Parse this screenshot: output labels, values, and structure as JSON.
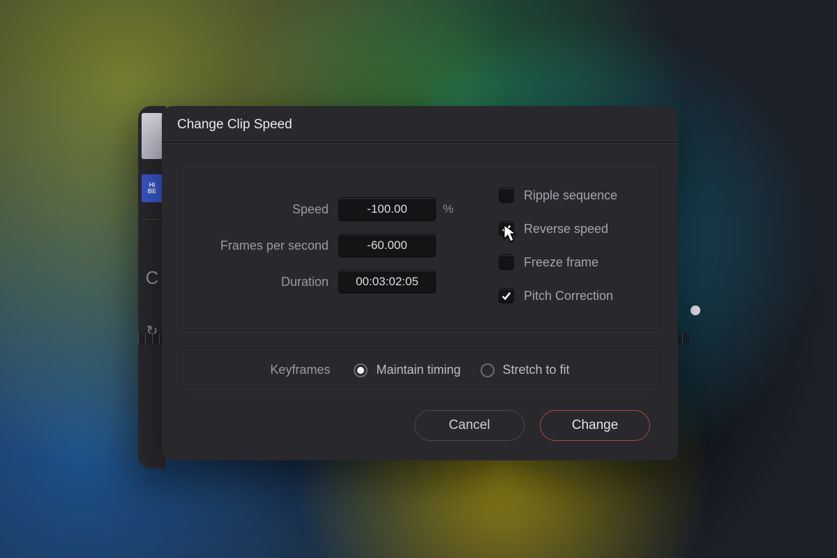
{
  "dialog": {
    "title": "Change Clip Speed",
    "fields": {
      "speed": {
        "label": "Speed",
        "value": "-100.00",
        "unit": "%"
      },
      "fps": {
        "label": "Frames per second",
        "value": "-60.000"
      },
      "duration": {
        "label": "Duration",
        "value": "00:03:02:05"
      }
    },
    "checkboxes": {
      "ripple": {
        "label": "Ripple sequence",
        "checked": false
      },
      "reverse": {
        "label": "Reverse speed",
        "checked": true
      },
      "freeze": {
        "label": "Freeze frame",
        "checked": false
      },
      "pitch": {
        "label": "Pitch Correction",
        "checked": true
      }
    },
    "keyframes": {
      "label": "Keyframes",
      "options": {
        "maintain": {
          "label": "Maintain timing",
          "selected": true
        },
        "stretch": {
          "label": "Stretch to fit",
          "selected": false
        }
      }
    },
    "buttons": {
      "cancel": "Cancel",
      "change": "Change"
    }
  },
  "background": {
    "thumb1_text": "",
    "thumb2_text": "HI\nBE",
    "glyph_c": "C",
    "glyph_arrow": "↻"
  },
  "colors": {
    "panel_bg": "#28282d",
    "input_bg": "#141417",
    "primary_border": "#b24a44",
    "text_muted": "#9a9aa3"
  }
}
